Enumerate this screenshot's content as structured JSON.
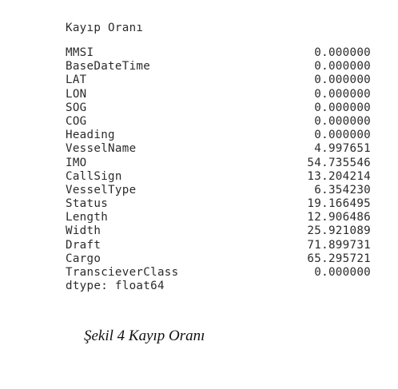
{
  "output": {
    "heading": "Kayıp Oranı",
    "rows": [
      {
        "name": "MMSI",
        "value": "0.000000"
      },
      {
        "name": "BaseDateTime",
        "value": "0.000000"
      },
      {
        "name": "LAT",
        "value": "0.000000"
      },
      {
        "name": "LON",
        "value": "0.000000"
      },
      {
        "name": "SOG",
        "value": "0.000000"
      },
      {
        "name": "COG",
        "value": "0.000000"
      },
      {
        "name": "Heading",
        "value": "0.000000"
      },
      {
        "name": "VesselName",
        "value": "4.997651"
      },
      {
        "name": "IMO",
        "value": "54.735546"
      },
      {
        "name": "CallSign",
        "value": "13.204214"
      },
      {
        "name": "VesselType",
        "value": "6.354230"
      },
      {
        "name": "Status",
        "value": "19.166495"
      },
      {
        "name": "Length",
        "value": "12.906486"
      },
      {
        "name": "Width",
        "value": "25.921089"
      },
      {
        "name": "Draft",
        "value": "71.899731"
      },
      {
        "name": "Cargo",
        "value": "65.295721"
      },
      {
        "name": "TranscieverClass",
        "value": "0.000000"
      }
    ],
    "dtype": "dtype: float64"
  },
  "caption": "Şekil 4 Kayıp Oranı"
}
